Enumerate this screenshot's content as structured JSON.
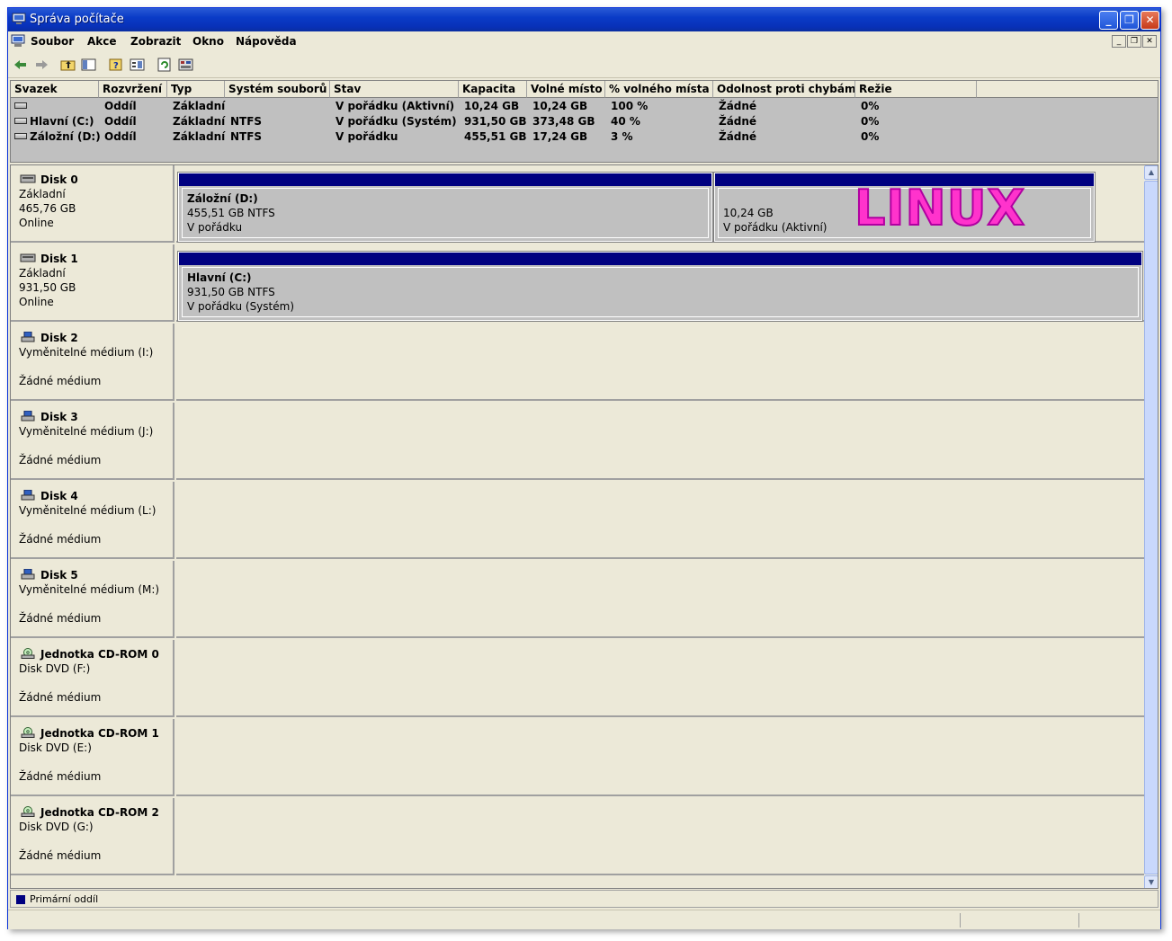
{
  "window": {
    "title": "Správa počítače"
  },
  "menu": [
    "Soubor",
    "Akce",
    "Zobrazit",
    "Okno",
    "Nápověda"
  ],
  "volume_table": {
    "columns": [
      "Svazek",
      "Rozvržení",
      "Typ",
      "Systém souborů",
      "Stav",
      "Kapacita",
      "Volné místo",
      "% volného místa",
      "Odolnost proti chybám",
      "Režie"
    ],
    "rows": [
      {
        "volume": "",
        "layout": "Oddíl",
        "type": "Základní",
        "fs": "",
        "status": "V pořádku (Aktivní)",
        "capacity": "10,24 GB",
        "free": "10,24 GB",
        "free_pct": "100 %",
        "fault": "Žádné",
        "overhead": "0%"
      },
      {
        "volume": "Hlavní (C:)",
        "layout": "Oddíl",
        "type": "Základní",
        "fs": "NTFS",
        "status": "V pořádku (Systém)",
        "capacity": "931,50 GB",
        "free": "373,48 GB",
        "free_pct": "40 %",
        "fault": "Žádné",
        "overhead": "0%"
      },
      {
        "volume": "Záložní (D:)",
        "layout": "Oddíl",
        "type": "Základní",
        "fs": "NTFS",
        "status": "V pořádku",
        "capacity": "455,51 GB",
        "free": "17,24 GB",
        "free_pct": "3 %",
        "fault": "Žádné",
        "overhead": "0%"
      }
    ]
  },
  "disks": [
    {
      "name": "Disk 0",
      "line1": "Základní",
      "line2": "465,76 GB",
      "line3": "Online",
      "icon": "hard-disk-icon",
      "partitions": [
        {
          "title": "Záložní  (D:)",
          "size": "455,51 GB NTFS",
          "status": "V pořádku"
        },
        {
          "title": "",
          "size": "10,24 GB",
          "status": "V pořádku (Aktivní)"
        }
      ]
    },
    {
      "name": "Disk 1",
      "line1": "Základní",
      "line2": "931,50 GB",
      "line3": "Online",
      "icon": "hard-disk-icon",
      "partitions": [
        {
          "title": "Hlavní  (C:)",
          "size": "931,50 GB NTFS",
          "status": "V pořádku (Systém)"
        }
      ]
    },
    {
      "name": "Disk 2",
      "line1": "Vyměnitelné médium (I:)",
      "line2": "",
      "line3": "Žádné médium",
      "icon": "removable-disk-icon",
      "partitions": []
    },
    {
      "name": "Disk 3",
      "line1": "Vyměnitelné médium (J:)",
      "line2": "",
      "line3": "Žádné médium",
      "icon": "removable-disk-icon",
      "partitions": []
    },
    {
      "name": "Disk 4",
      "line1": "Vyměnitelné médium (L:)",
      "line2": "",
      "line3": "Žádné médium",
      "icon": "removable-disk-icon",
      "partitions": []
    },
    {
      "name": "Disk 5",
      "line1": "Vyměnitelné médium (M:)",
      "line2": "",
      "line3": "Žádné médium",
      "icon": "removable-disk-icon",
      "partitions": []
    },
    {
      "name": "Jednotka CD-ROM 0",
      "line1": "Disk DVD (F:)",
      "line2": "",
      "line3": "Žádné médium",
      "icon": "cd-rom-icon",
      "partitions": []
    },
    {
      "name": "Jednotka CD-ROM 1",
      "line1": "Disk DVD (E:)",
      "line2": "",
      "line3": "Žádné médium",
      "icon": "cd-rom-icon",
      "partitions": []
    },
    {
      "name": "Jednotka CD-ROM 2",
      "line1": "Disk DVD (G:)",
      "line2": "",
      "line3": "Žádné médium",
      "icon": "cd-rom-icon",
      "partitions": []
    }
  ],
  "overlay_label": "LINUX",
  "legend": {
    "label": "Primární oddíl",
    "color": "#000080"
  },
  "colors": {
    "partition_bar": "#000080",
    "overlay": "#ff33cc",
    "titlebar": "#0a3bc7"
  }
}
